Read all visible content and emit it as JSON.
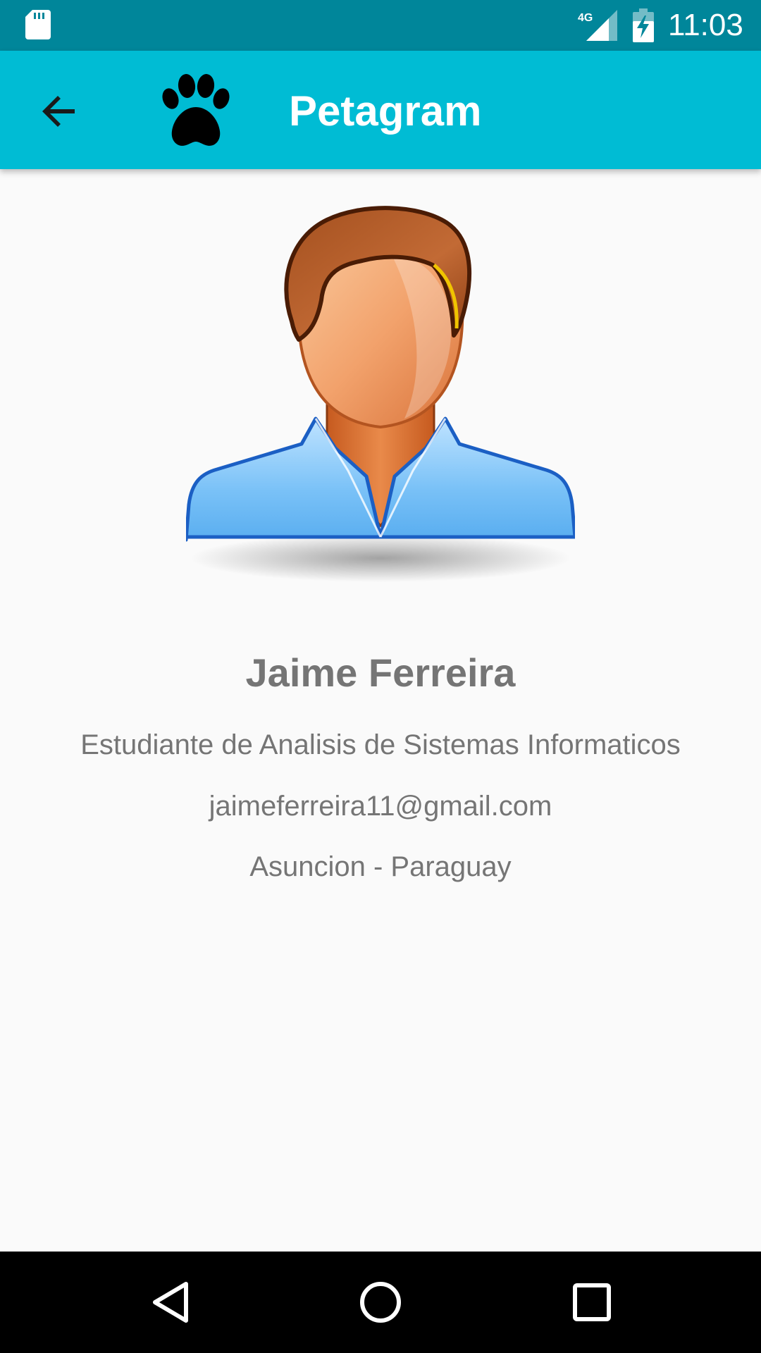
{
  "status_bar": {
    "time": "11:03",
    "network": "4G",
    "icons": [
      "sd-card-icon",
      "signal-4g-icon",
      "battery-charging-icon"
    ]
  },
  "app_bar": {
    "title": "Petagram",
    "icons": [
      "back-arrow-icon",
      "paw-icon"
    ],
    "color": "#00bcd4"
  },
  "profile": {
    "name": "Jaime Ferreira",
    "occupation": "Estudiante de Analisis de Sistemas Informaticos",
    "email": "jaimeferreira11@gmail.com",
    "location": "Asuncion - Paraguay",
    "avatar": "person-avatar-icon"
  },
  "nav_bar": {
    "icons": [
      "nav-back-icon",
      "nav-home-icon",
      "nav-recents-icon"
    ]
  },
  "colors": {
    "status_bar": "#00869a",
    "primary": "#00bcd4",
    "text_secondary": "#757575",
    "background": "#fafafa"
  }
}
